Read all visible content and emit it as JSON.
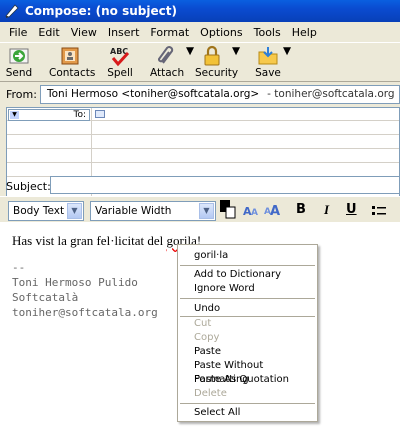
{
  "window": {
    "title": "Compose: (no subject)"
  },
  "menubar": {
    "file": "File",
    "edit": "Edit",
    "view": "View",
    "insert": "Insert",
    "format": "Format",
    "options": "Options",
    "tools": "Tools",
    "help": "Help"
  },
  "toolbar": {
    "send": "Send",
    "contacts": "Contacts",
    "spell": "Spell",
    "attach": "Attach",
    "security": "Security",
    "save": "Save"
  },
  "from": {
    "label": "From:",
    "identity": "Toni Hermoso <toniher@softcatala.org>",
    "account": "- toniher@softcatala.org"
  },
  "recipients": {
    "type": "To:"
  },
  "subject": {
    "label": "Subject:",
    "value": ""
  },
  "format": {
    "paragraph": "Body Text",
    "font": "Variable Width",
    "bold": "B",
    "italic": "I",
    "underline": "U"
  },
  "message": {
    "before": "Has vist la gran fel·licitat del ",
    "misspelled": "gorila",
    "after": "!",
    "signature": "--\nToni Hermoso Pulido\nSoftcatalà\ntoniher@softcatala.org"
  },
  "context_menu": {
    "suggestion": "goril·la",
    "add_to_dictionary": "Add to Dictionary",
    "ignore_word": "Ignore Word",
    "undo": "Undo",
    "cut": "Cut",
    "copy": "Copy",
    "paste": "Paste",
    "paste_without_formatting": "Paste Without Formatting",
    "paste_as_quotation": "Paste As Quotation",
    "delete": "Delete",
    "select_all": "Select All"
  }
}
